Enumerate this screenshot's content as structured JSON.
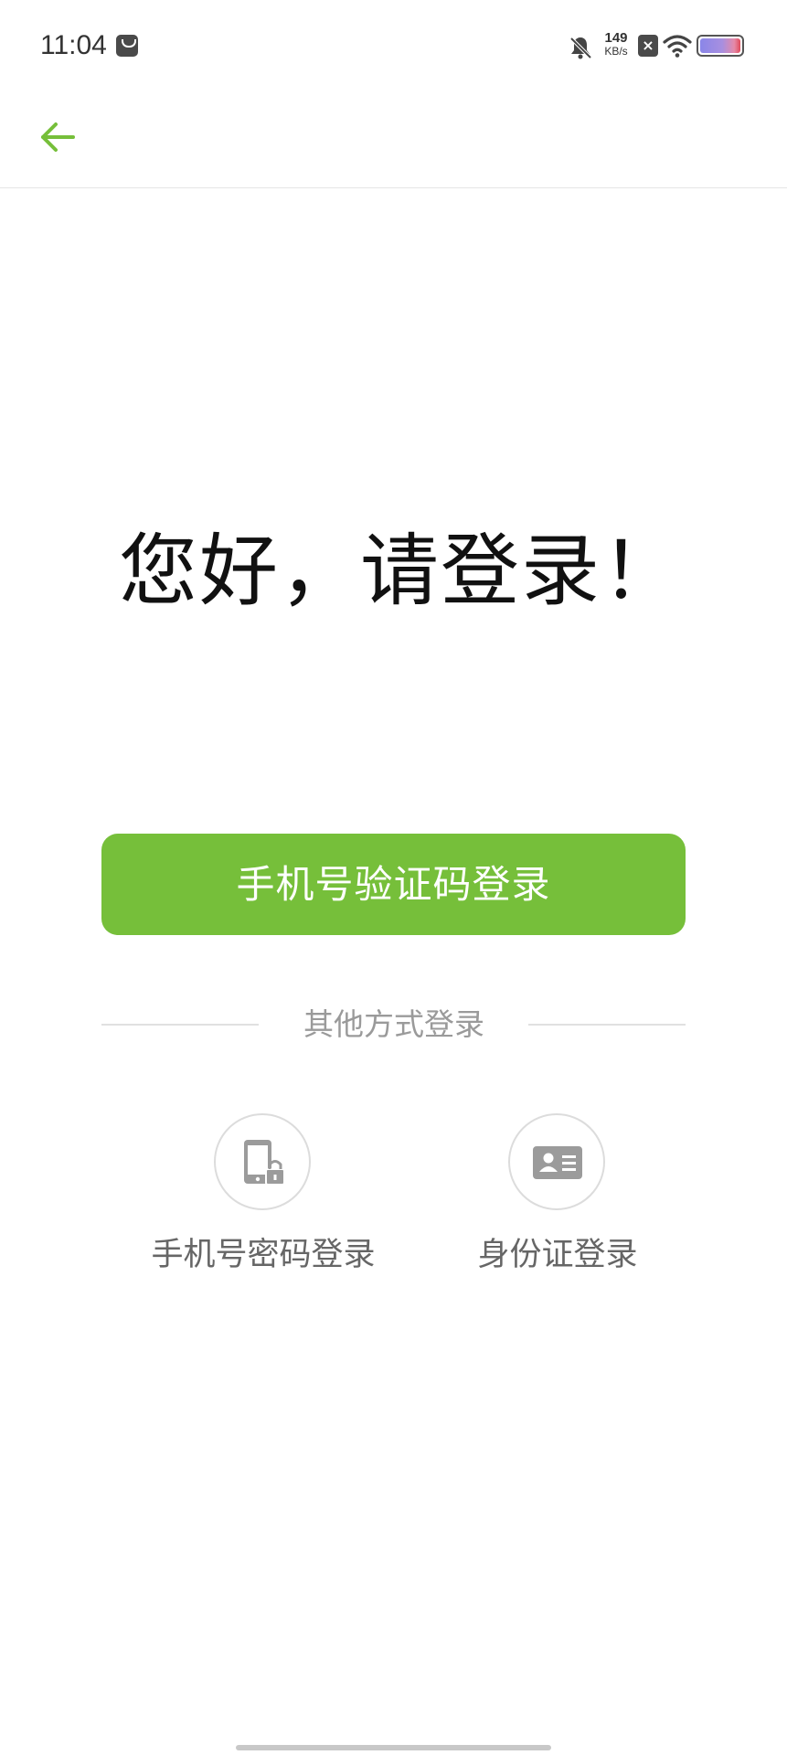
{
  "status_bar": {
    "time": "11:04",
    "network_speed_value": "149",
    "network_speed_unit": "KB/s",
    "icons": [
      "notification-app-icon",
      "bell-off-icon",
      "sim-x-icon",
      "wifi-icon",
      "battery-icon"
    ]
  },
  "nav": {
    "back_icon": "arrow-left-icon"
  },
  "greeting": "您好，请登录！",
  "primary_button": {
    "label": "手机号验证码登录"
  },
  "other_methods": {
    "label": "其他方式登录",
    "options": [
      {
        "label": "手机号密码登录",
        "icon": "phone-lock-icon"
      },
      {
        "label": "身份证登录",
        "icon": "id-card-icon"
      }
    ]
  },
  "colors": {
    "accent": "#76bf3a",
    "text_primary": "#111111",
    "text_secondary": "#666666",
    "text_muted": "#9a9a9a",
    "icon_gray": "#9b9b9b"
  }
}
